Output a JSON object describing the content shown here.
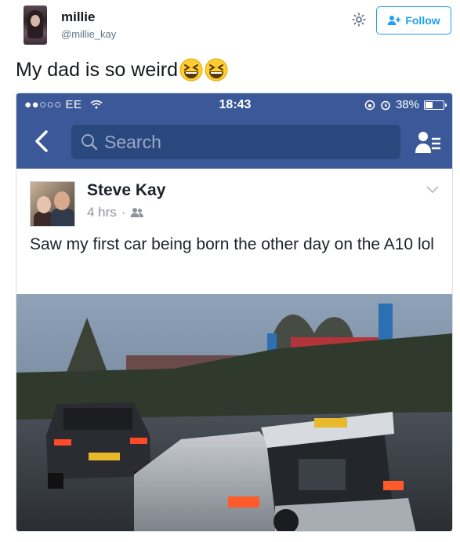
{
  "tweet": {
    "display_name": "millie",
    "screen_name": "@millie_kay",
    "follow_label": "Follow",
    "text": "My dad is so weird",
    "emoji": [
      "grinning-squinting-face",
      "grinning-squinting-face"
    ]
  },
  "phone": {
    "status": {
      "carrier": "●●○○○ EE",
      "time": "18:43",
      "battery": "38%",
      "battery_level": 0.38
    },
    "search_placeholder": "Search",
    "post": {
      "author": "Steve Kay",
      "time": "4 hrs",
      "separator": "·",
      "text": "Saw my first car being born the other day on the A10 lol"
    },
    "photo": {
      "plate_rear_car": "",
      "plate_front_car": ""
    }
  },
  "icons": {
    "gear": "gear-icon",
    "follow": "add-user-icon",
    "back": "back-chevron-icon",
    "search": "search-icon",
    "friends": "friend-requests-icon",
    "audience": "friends-audience-icon",
    "options": "chevron-down-icon"
  },
  "colors": {
    "twitter_blue": "#1da1f2",
    "facebook_blue": "#3b5998",
    "facebook_search": "#29487d"
  }
}
